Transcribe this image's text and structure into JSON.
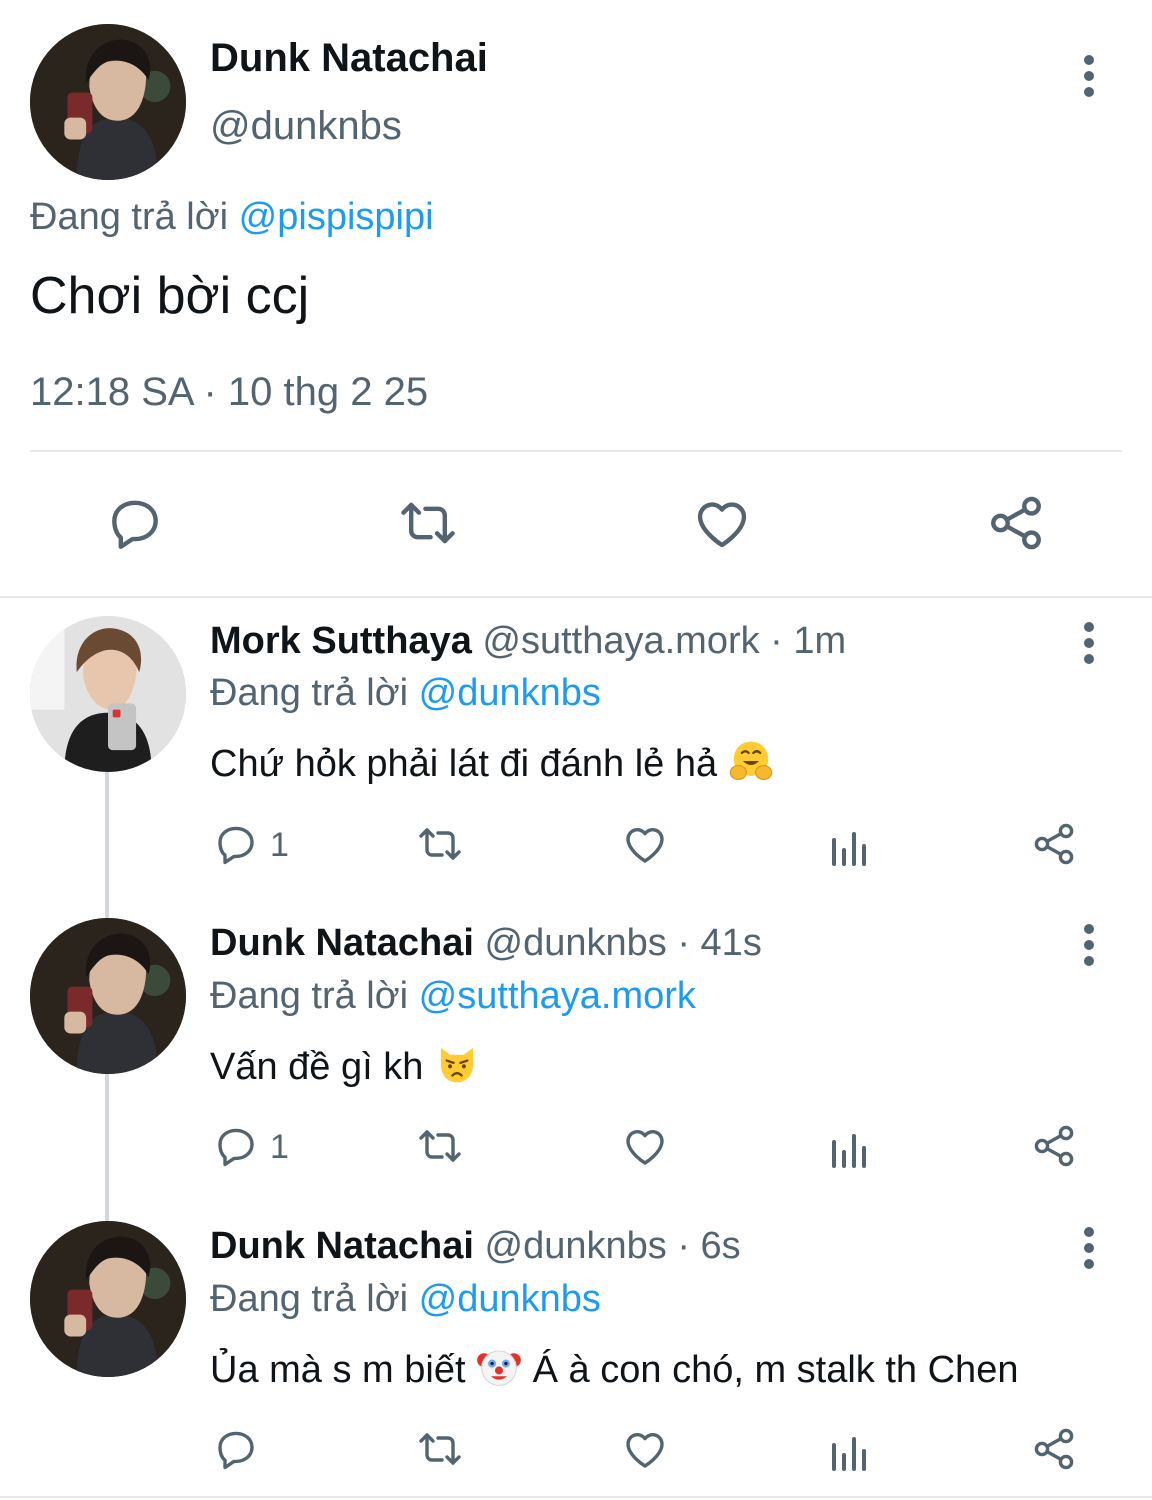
{
  "main_tweet": {
    "author_name": "Dunk Natachai",
    "author_handle": "@dunknbs",
    "replying_prefix": "Đang trả lời",
    "replying_to": "@pispispipi",
    "text": "Chơi bời ccj",
    "timestamp": "12:18 SA · 10 thg 2 25"
  },
  "replies": [
    {
      "author_name": "Mork Sutthaya",
      "handle_time": "@sutthaya.mork · 1m",
      "replying_prefix": "Đang trả lời",
      "replying_to": "@dunknbs",
      "text": "Chứ hỏk phải lát đi đánh lẻ hả",
      "emoji": "hugging-face",
      "reply_count": "1"
    },
    {
      "author_name": "Dunk Natachai",
      "handle_time": "@dunknbs · 41s",
      "replying_prefix": "Đang trả lời",
      "replying_to": "@sutthaya.mork",
      "text": "Vấn đề gì kh",
      "emoji": "pouting-cat",
      "reply_count": "1"
    },
    {
      "author_name": "Dunk Natachai",
      "handle_time": "@dunknbs · 6s",
      "replying_prefix": "Đang trả lời",
      "replying_to": "@dunknbs",
      "text_before_emoji": "Ủa mà s m biết",
      "emoji": "clown-face",
      "text_after_emoji": "Á à con chó, m stalk th Chen"
    }
  ],
  "colors": {
    "text_primary": "#0f1419",
    "text_secondary": "#536471",
    "mention": "#1d9bf0",
    "divider": "#e6e9ec"
  },
  "icons": [
    "reply-icon",
    "retweet-icon",
    "like-icon",
    "share-icon",
    "views-icon",
    "more-icon"
  ]
}
